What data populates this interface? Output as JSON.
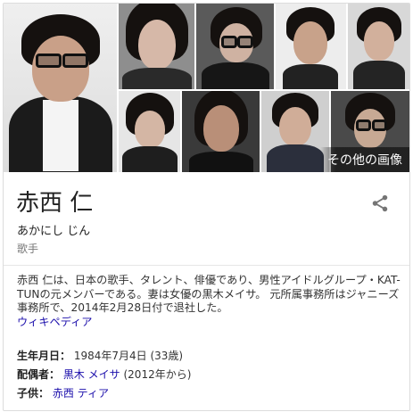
{
  "gallery": {
    "more_images": "その他の画像"
  },
  "entity": {
    "name": "赤西 仁",
    "reading": "あかにし じん",
    "type": "歌手"
  },
  "description": {
    "text": "赤西 仁は、日本の歌手、タレント、俳優であり、男性アイドルグループ・KAT-TUNの元メンバーである。妻は女優の黒木メイサ。 元所属事務所はジャニーズ事務所で、2014年2月28日付で退社した。",
    "source_link": "ウィキペディア"
  },
  "facts": {
    "birth": {
      "label": "生年月日：",
      "value": "1984年7月4日 (33歳)"
    },
    "spouse": {
      "label": "配偶者：",
      "link": "黒木 メイサ",
      "note": " (2012年から)"
    },
    "child": {
      "label": "子供：",
      "link": "赤西 ティア"
    }
  },
  "icons": {
    "share": "share-icon"
  },
  "colors": {
    "link": "#1a0dab",
    "muted": "#777777"
  }
}
